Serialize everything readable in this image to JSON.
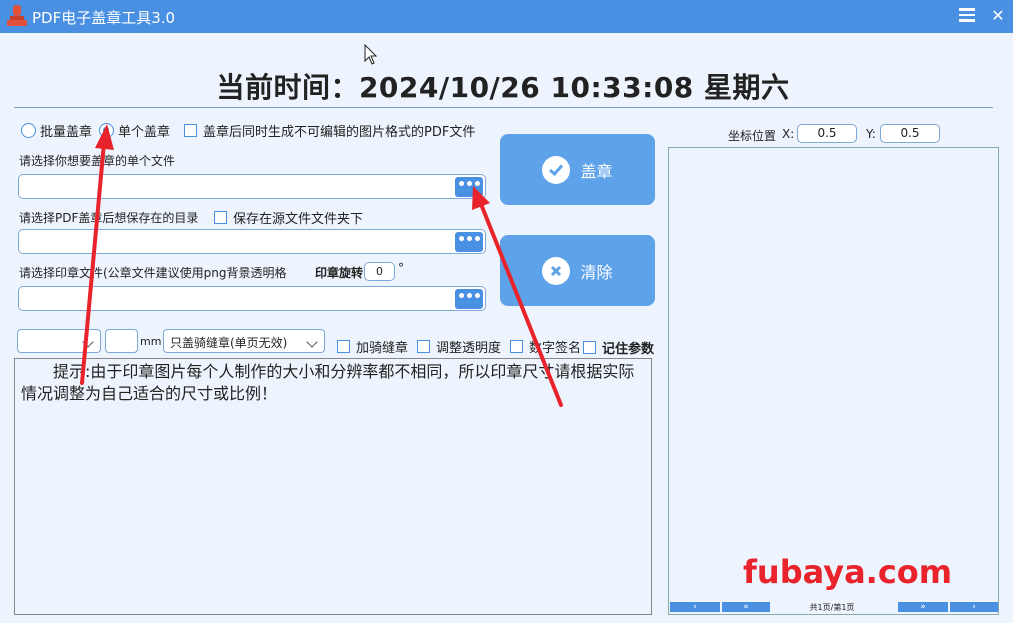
{
  "window": {
    "title": "PDF电子盖章工具3.0",
    "close_glyph": "✕"
  },
  "clock": {
    "text": "当前时间：2024/10/26 10:33:08  星期六"
  },
  "mode": {
    "batch_label": "批量盖章",
    "single_label": "单个盖章",
    "selected": "single",
    "image_pdf_label": "盖章后同时生成不可编辑的图片格式的PDF文件"
  },
  "source_file": {
    "label": "请选择你想要盖章的单个文件",
    "value": "",
    "browse_glyph": "•••"
  },
  "output_dir": {
    "label": "请选择PDF盖章后想保存在的目录",
    "save_in_source_label": "保存在源文件文件夹下",
    "value": "",
    "browse_glyph": "•••"
  },
  "seal_file": {
    "label": "请选择印章文件(公章文件建议使用png背景透明格",
    "rotation_label": "印章旋转",
    "rotation_value": "0",
    "rotation_unit": "°",
    "value": "",
    "browse_glyph": "•••"
  },
  "actions": {
    "stamp_label": "盖章",
    "clear_label": "清除"
  },
  "options": {
    "size_unit": "mm",
    "seam_mode": "只盖骑缝章(单页无效)",
    "seam_label": "加骑缝章",
    "opacity_label": "调整透明度",
    "signature_label": "数字签名",
    "remember_label": "记住参数"
  },
  "tips": {
    "text": "提示:由于印章图片每个人制作的大小和分辨率都不相同，所以印章尺寸请根据实际情况调整为自己适合的尺寸或比例！"
  },
  "coords": {
    "label": "坐标位置",
    "x_label": "X:",
    "x_value": "0.5",
    "y_label": "Y:",
    "y_value": "0.5"
  },
  "pager": {
    "first": "‹",
    "prev": "«",
    "status": "共1页/第1页",
    "next": "»",
    "last": "›"
  },
  "watermark": "fubaya.com",
  "colors": {
    "accent": "#4a90e2",
    "annotation": "#e8232b"
  }
}
